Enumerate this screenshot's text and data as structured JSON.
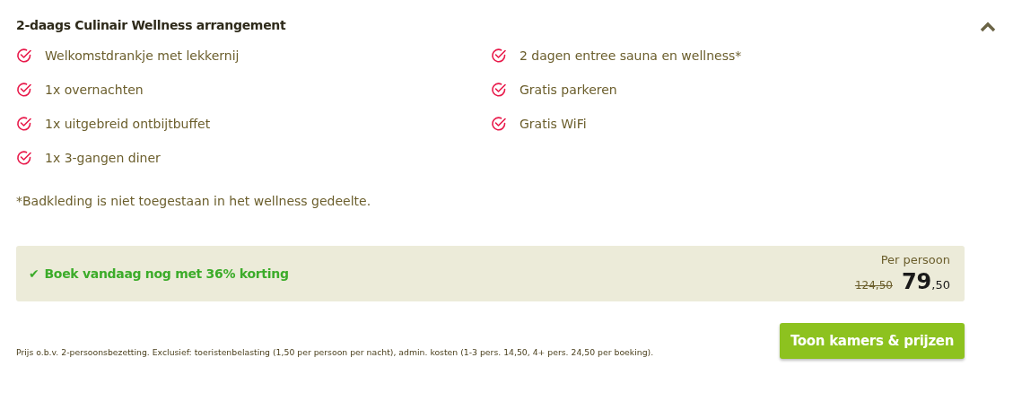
{
  "package": {
    "title": "2-daags Culinair Wellness arrangement",
    "expanded": true,
    "features_left": [
      "Welkomstdrankje met lekkernij",
      "1x overnachten",
      "1x uitgebreid ontbijtbuffet",
      "1x 3-gangen diner"
    ],
    "features_right": [
      "2 dagen entree sauna en wellness*",
      "Gratis parkeren",
      "Gratis WiFi"
    ],
    "note": "*Badkleding is niet toegestaan in het wellness gedeelte."
  },
  "offer": {
    "check": "✔",
    "text": "Boek vandaag nog met 36% korting",
    "per_label": "Per persoon",
    "old_price": "124,50",
    "price": "79",
    "price_decimals": ",50"
  },
  "footer": {
    "disclaimer": "Prijs o.b.v. 2-persoonsbezetting. Exclusief: toeristenbelasting (1,50 per persoon per nacht), admin. kosten (1-3 pers. 14,50, 4+ pers. 24,50 per boeking).",
    "button": "Toon kamers & prijzen"
  }
}
